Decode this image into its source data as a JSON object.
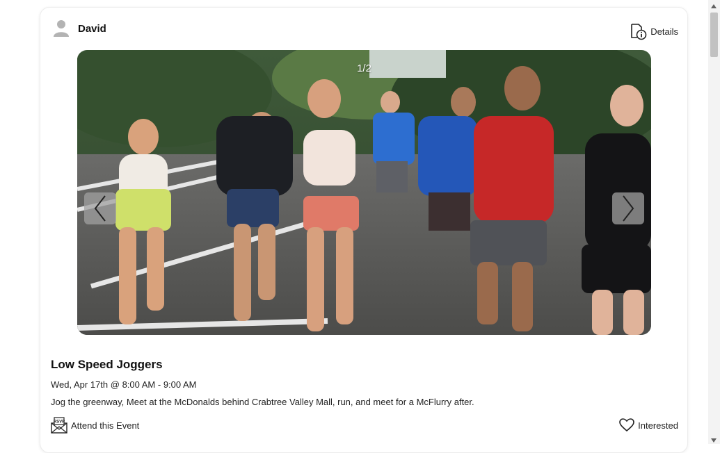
{
  "post": {
    "author": "David",
    "details_label": "Details"
  },
  "carousel": {
    "counter": "1/2",
    "image_description": "group of runners jogging on a park road"
  },
  "event": {
    "title": "Low Speed Joggers",
    "datetime": "Wed, Apr 17th @ 8:00 AM - 9:00 AM",
    "description": "Jog the greenway, Meet at the McDonalds behind Crabtree Valley Mall, run, and meet for a McFlurry after."
  },
  "actions": {
    "attend_label": "Attend this Event",
    "interested_label": "Interested"
  },
  "icons": {
    "avatar": "user-avatar-icon",
    "details": "document-info-icon",
    "prev": "chevron-left-icon",
    "next": "chevron-right-icon",
    "attend": "rsvp-envelope-icon",
    "interested": "heart-icon"
  }
}
